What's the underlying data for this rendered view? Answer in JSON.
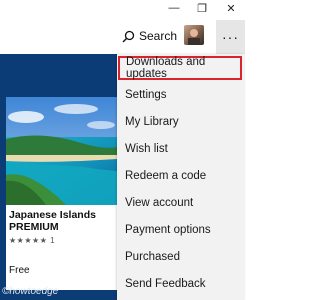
{
  "window": {
    "minimize_glyph": "—",
    "maximize_glyph": "❐",
    "close_glyph": "✕"
  },
  "toolbar": {
    "search_label": "Search",
    "more_label": "···"
  },
  "menu": {
    "items": [
      {
        "label": "Downloads and updates",
        "highlighted": true
      },
      {
        "label": "Settings"
      },
      {
        "label": "My Library"
      },
      {
        "label": "Wish list"
      },
      {
        "label": "Redeem a code"
      },
      {
        "label": "View account"
      },
      {
        "label": "Payment options"
      },
      {
        "label": "Purchased"
      },
      {
        "label": "Send Feedback"
      }
    ]
  },
  "card": {
    "title": "Japanese Islands PREMIUM",
    "rating_stars": "★★★★★",
    "rating_count": "1",
    "price": "Free"
  },
  "watermark": "©howtoedge",
  "colors": {
    "accent": "#d9232f",
    "store_background": "#0c3c76",
    "menu_background": "#f2f2f2"
  }
}
